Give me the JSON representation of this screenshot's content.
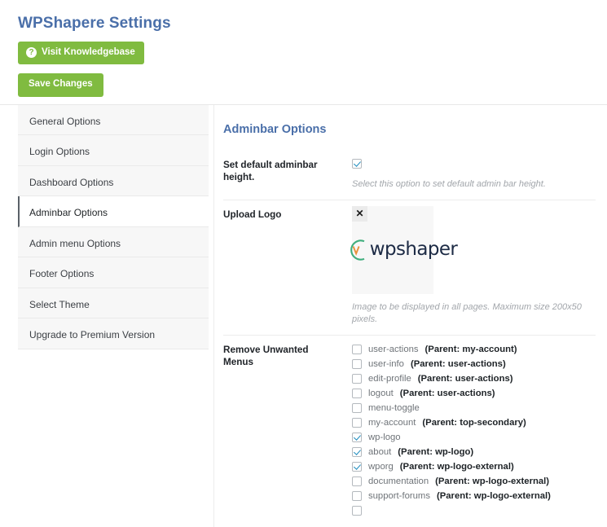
{
  "header": {
    "title": "WPShapere Settings",
    "knowledgebase_button": "Visit Knowledgebase",
    "knowledgebase_icon": "question-mark-icon",
    "save_button": "Save Changes"
  },
  "colors": {
    "title_blue": "#4a6fa9",
    "button_green": "#80bb40",
    "checkbox_blue": "#1e8cbe",
    "active_border": "#5a6168",
    "logo_navy": "#1d2b45",
    "logo_arc_green": "#3fae7d",
    "logo_accent_orange": "#e8913a"
  },
  "sidebar": {
    "items": [
      {
        "label": "General Options",
        "active": false
      },
      {
        "label": "Login Options",
        "active": false
      },
      {
        "label": "Dashboard Options",
        "active": false
      },
      {
        "label": "Adminbar Options",
        "active": true
      },
      {
        "label": "Admin menu Options",
        "active": false
      },
      {
        "label": "Footer Options",
        "active": false
      },
      {
        "label": "Select Theme",
        "active": false
      },
      {
        "label": "Upgrade to Premium Version",
        "active": false
      }
    ]
  },
  "main": {
    "section_title": "Adminbar Options",
    "rows": {
      "adminbar_height": {
        "label": "Set default adminbar height.",
        "checked": true,
        "helper": "Select this option to set default admin bar height."
      },
      "upload_logo": {
        "label": "Upload Logo",
        "close_icon": "close-icon",
        "close_glyph": "✕",
        "logo_text": "wpshaper",
        "helper": "Image to be displayed in all pages. Maximum size 200x50 pixels."
      },
      "remove_menus": {
        "label": "Remove Unwanted Menus",
        "items": [
          {
            "name": "user-actions",
            "parent": "(Parent: my-account)",
            "checked": false
          },
          {
            "name": "user-info",
            "parent": "(Parent: user-actions)",
            "checked": false
          },
          {
            "name": "edit-profile",
            "parent": "(Parent: user-actions)",
            "checked": false
          },
          {
            "name": "logout",
            "parent": "(Parent: user-actions)",
            "checked": false
          },
          {
            "name": "menu-toggle",
            "parent": "",
            "checked": false
          },
          {
            "name": "my-account",
            "parent": "(Parent: top-secondary)",
            "checked": false
          },
          {
            "name": "wp-logo",
            "parent": "",
            "checked": true
          },
          {
            "name": "about",
            "parent": "(Parent: wp-logo)",
            "checked": true
          },
          {
            "name": "wporg",
            "parent": "(Parent: wp-logo-external)",
            "checked": true
          },
          {
            "name": "documentation",
            "parent": "(Parent: wp-logo-external)",
            "checked": false
          },
          {
            "name": "support-forums",
            "parent": "(Parent: wp-logo-external)",
            "checked": false
          },
          {
            "name": "",
            "parent": "",
            "checked": false
          }
        ]
      }
    }
  }
}
